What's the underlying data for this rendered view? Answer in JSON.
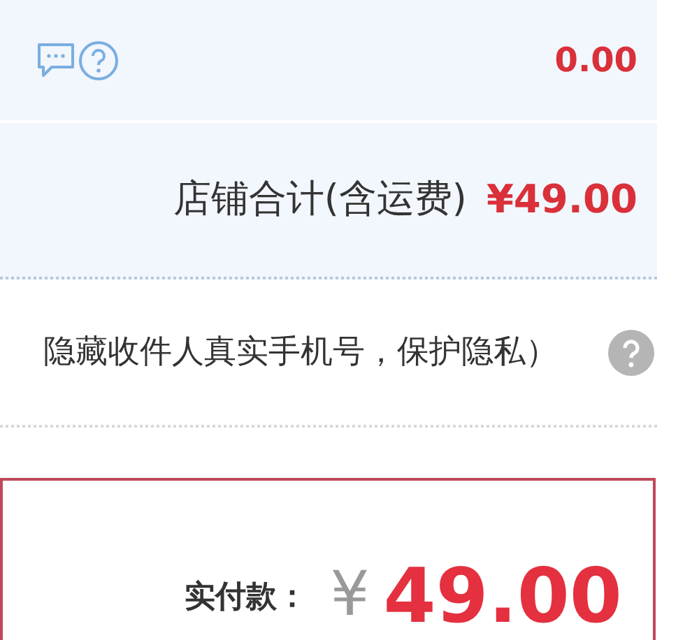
{
  "shop": {
    "discount_row": {
      "value": "0.00"
    },
    "total_row": {
      "label": "店铺合计(含运费)",
      "value": "¥49.00"
    }
  },
  "privacy_row": {
    "text": "隐藏收件人真实手机号，保护隐私）"
  },
  "payment": {
    "label": "实付款：",
    "currency": "¥",
    "amount": "49.00"
  }
}
